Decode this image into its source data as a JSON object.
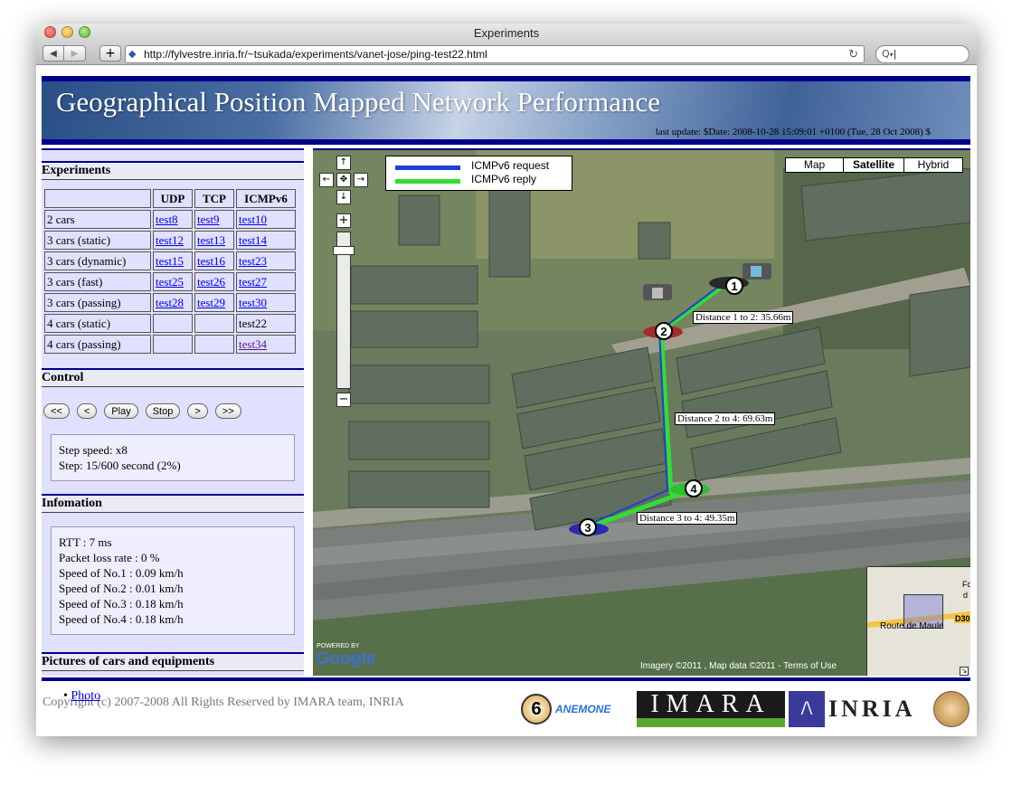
{
  "window": {
    "title": "Experiments"
  },
  "browser": {
    "url": "http://fylvestre.inria.fr/~tsukada/experiments/vanet-jose/ping-test22.html",
    "search_placeholder": "Q"
  },
  "banner": {
    "title": "Geographical Position Mapped Network Performance",
    "update": "last update: $Date: 2008-10-28 15:09:01 +0100 (Tue, 28 Oct 2008) $"
  },
  "experiments": {
    "heading": "Experiments",
    "headers": [
      "",
      "UDP",
      "TCP",
      "ICMPv6"
    ],
    "rows": [
      {
        "label": "2 cars",
        "udp": "test8",
        "tcp": "test9",
        "icmp": "test10"
      },
      {
        "label": "3 cars (static)",
        "udp": "test12",
        "tcp": "test13",
        "icmp": "test14"
      },
      {
        "label": "3 cars (dynamic)",
        "udp": "test15",
        "tcp": "test16",
        "icmp": "test23"
      },
      {
        "label": "3 cars (fast)",
        "udp": "test25",
        "tcp": "test26",
        "icmp": "test27"
      },
      {
        "label": "3 cars (passing)",
        "udp": "test28",
        "tcp": "test29",
        "icmp": "test30"
      },
      {
        "label": "4 cars (static)",
        "udp": "",
        "tcp": "",
        "icmp": "test22"
      },
      {
        "label": "4 cars (passing)",
        "udp": "",
        "tcp": "",
        "icmp": "test34"
      }
    ]
  },
  "control": {
    "heading": "Control",
    "buttons": [
      "<<",
      "<",
      "Play",
      "Stop",
      ">",
      ">>"
    ],
    "step_speed": "Step speed: x8",
    "step": "Step: 15/600 second (2%)"
  },
  "information": {
    "heading": "Infomation",
    "lines": [
      "RTT : 7 ms",
      "Packet loss rate : 0 %",
      "Speed of No.1 : 0.09 km/h",
      "Speed of No.2 : 0.01 km/h",
      "Speed of No.3 : 0.18 km/h",
      "Speed of No.4 : 0.18 km/h"
    ]
  },
  "pictures": {
    "heading": "Pictures of cars and equipments",
    "link": "Photo"
  },
  "map": {
    "types": [
      "Map",
      "Satellite",
      "Hybrid"
    ],
    "selected_type": "Satellite",
    "legend": [
      {
        "label": "ICMPv6 request",
        "color": "#1f3fd6"
      },
      {
        "label": "ICMPv6 reply",
        "color": "#33dd33"
      }
    ],
    "nodes": [
      "1",
      "2",
      "3",
      "4"
    ],
    "distances": [
      "Distance 1 to 2: 35.66m",
      "Distance 2 to 4: 69.63m",
      "Distance 3 to 4: 49.35m"
    ],
    "attribution": "Imagery ©2011 , Map data ©2011 - Terms of Use",
    "powered_by": "POWERED BY",
    "google": "Google",
    "overview_road": "Route de Maule",
    "overview_road_code": "D30",
    "overview_fo": "Fo",
    "overview_d": "d"
  },
  "footer": {
    "copyright": "Copyright (c) 2007-2008 All Rights Reserved by IMARA team, INRIA",
    "imara": "IMARA",
    "inria": "INRIA",
    "anemone": "ANEMONE",
    "six": "6"
  }
}
